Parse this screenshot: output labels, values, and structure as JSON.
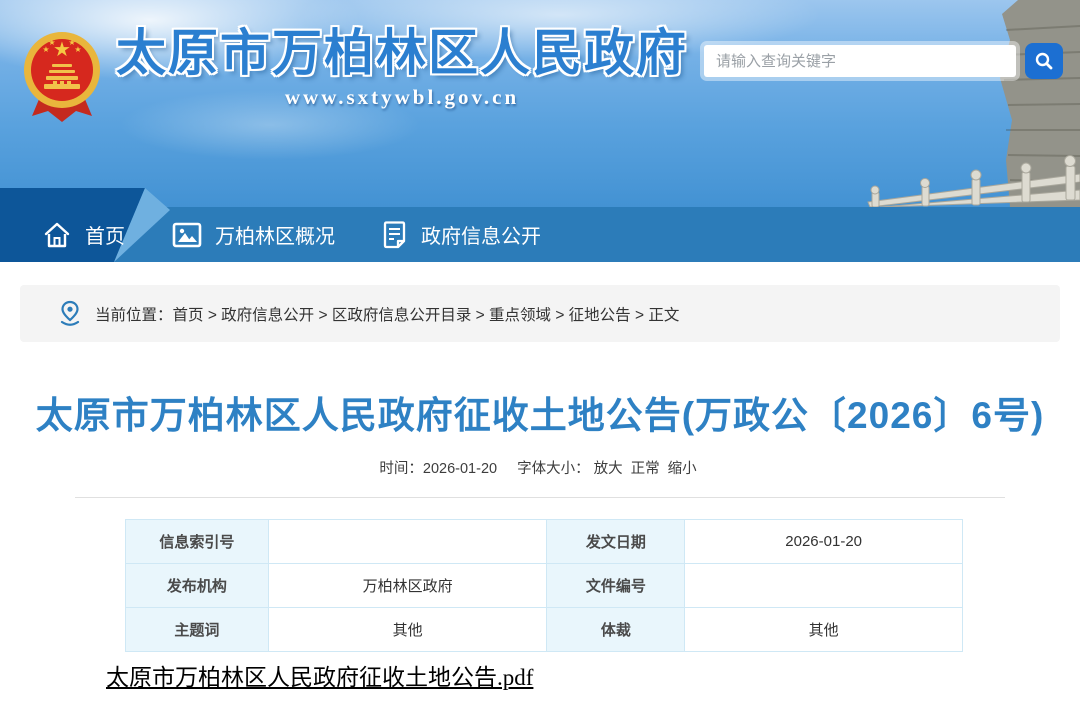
{
  "header": {
    "site_title": "太原市万柏林区人民政府",
    "site_url": "www.sxtywbl.gov.cn",
    "search": {
      "placeholder": "请输入查询关键字",
      "value": ""
    }
  },
  "nav": {
    "items": [
      {
        "label": "首页",
        "icon": "home-icon"
      },
      {
        "label": "万柏林区概况",
        "icon": "picture-icon"
      },
      {
        "label": "政府信息公开",
        "icon": "document-icon"
      }
    ]
  },
  "breadcrumb": {
    "prefix": "当前位置：",
    "separator": ">",
    "items": [
      "首页",
      "政府信息公开",
      "区政府信息公开目录",
      "重点领域",
      "征地公告",
      "正文"
    ],
    "icon": "location-pin-icon"
  },
  "article": {
    "title": "太原市万柏林区人民政府征收土地公告(万政公〔2026〕6号)",
    "meta": {
      "time_label": "时间：",
      "time": "2026-01-20",
      "fontsize_label": "字体大小：",
      "options": [
        "放大",
        "正常",
        "缩小"
      ]
    },
    "info_table": {
      "rows": [
        {
          "label1": "信息索引号",
          "value1": "",
          "label2": "发文日期",
          "value2": "2026-01-20"
        },
        {
          "label1": "发布机构",
          "value1": "万柏林区政府",
          "label2": "文件编号",
          "value2": ""
        },
        {
          "label1": "主题词",
          "value1": "其他",
          "label2": "体裁",
          "value2": "其他"
        }
      ]
    },
    "attachment": {
      "name": "太原市万柏林区人民政府征收土地公告.pdf"
    }
  },
  "colors": {
    "accent_blue": "#2e81c4",
    "nav_blue": "#2c7cb9",
    "nav_dark_blue": "#0d5699",
    "search_button_blue": "#1c6fd2",
    "table_border": "#cfe8f5",
    "table_label_bg": "#e9f6fc",
    "breadcrumb_bg": "#f4f4f4",
    "emblem_red": "#d6281e",
    "emblem_gold": "#f2c14a"
  }
}
